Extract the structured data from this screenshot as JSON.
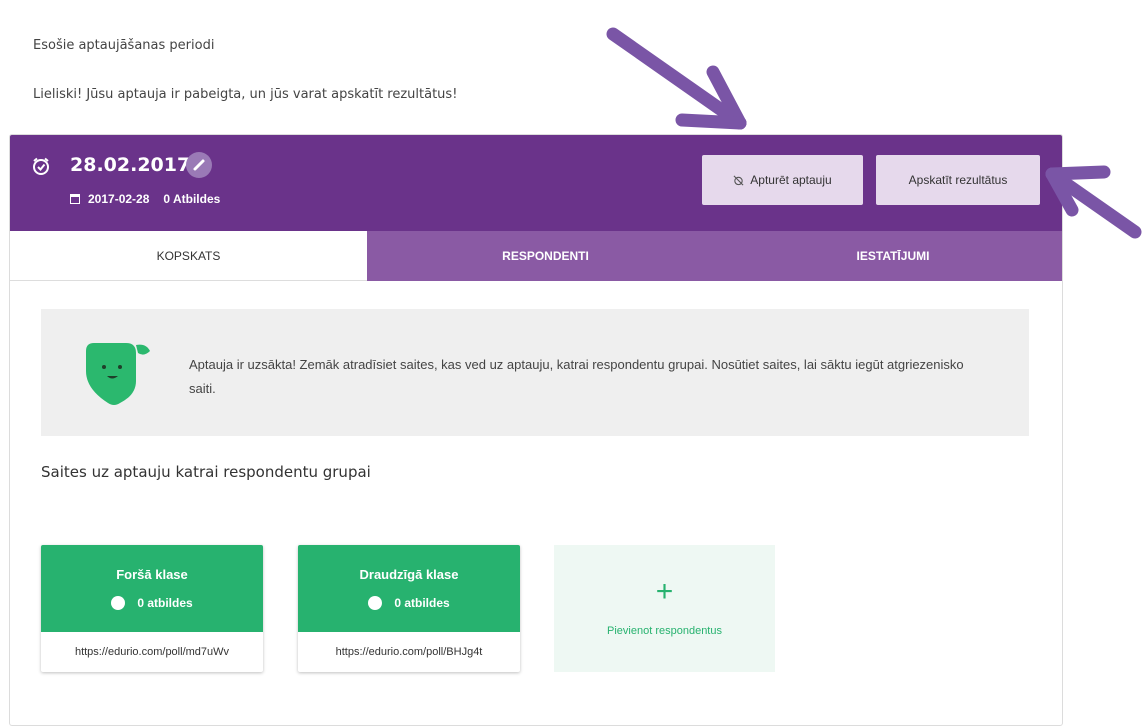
{
  "intro": {
    "periods_title": "Esošie aptaujāšanas periodi",
    "completion_message": "Lieliski! Jūsu aptauja ir pabeigta, un jūs varat apskatīt rezultātus!"
  },
  "period": {
    "title": "28.02.2017",
    "date": "2017-02-28",
    "answers": "0 Atbildes",
    "stop_button": "Apturēt aptauju",
    "view_results_button": "Apskatīt rezultātus"
  },
  "tabs": [
    {
      "label": "KOPSKATS",
      "active": true
    },
    {
      "label": "RESPONDENTI",
      "active": false
    },
    {
      "label": "IESTATĪJUMI",
      "active": false
    }
  ],
  "notice": {
    "text": "Aptauja ir uzsākta! Zemāk atradīsiet saites, kas ved uz aptauju, katrai respondentu grupai. Nosūtiet saites, lai sāktu iegūt atgriezenisko saiti."
  },
  "links_section_title": "Saites uz aptauju katrai respondentu grupai",
  "groups": [
    {
      "name": "Foršā klase",
      "count": "0 atbildes",
      "link": "https://edurio.com/poll/md7uWv"
    },
    {
      "name": "Draudzīgā klase",
      "count": "0 atbildes",
      "link": "https://edurio.com/poll/BHJg4t"
    }
  ],
  "add_respondents_label": "Pievienot respondentus",
  "add_respondents_symbol": "+",
  "colors": {
    "header_purple": "#6a338a",
    "tab_purple": "#8a5aa4",
    "button_light": "#e6d9ec",
    "green": "#27b26f",
    "arrow": "#7a55a6"
  }
}
